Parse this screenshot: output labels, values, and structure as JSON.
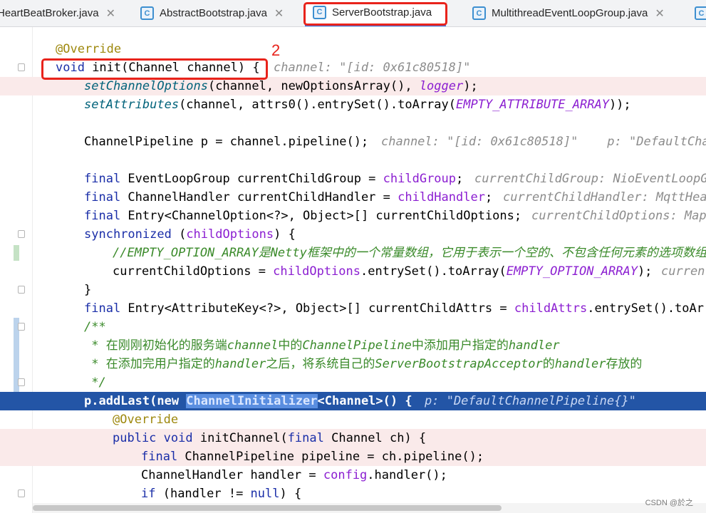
{
  "tabs": [
    {
      "label": "HeartBeatBroker.java",
      "icon": "java-class-icon"
    },
    {
      "label": "AbstractBootstrap.java",
      "icon": "java-class-icon"
    },
    {
      "label": "ServerBootstrap.java",
      "icon": "java-class-icon",
      "active": true
    },
    {
      "label": "MultithreadEventLoopGroup.java",
      "icon": "java-class-icon"
    }
  ],
  "annotations": {
    "step_number": "2"
  },
  "watermark": "CSDN @於之",
  "colors": {
    "marker": "#e8231b",
    "selection": "#2355a6",
    "breakpoint_line": "#faeaea",
    "keyword": "#1a2ea8"
  },
  "code": {
    "l1_override": "@Override",
    "l2_void": "void",
    "l2_init": " init(Channel channel) {",
    "l2_inlay": "channel: \"[id: 0x61c80518]\"",
    "l3_fn": "setChannelOptions",
    "l3_mid": "(channel, newOptionsArray(), ",
    "l3_logger": "logger",
    "l3_end": ");",
    "l4_fn": "setAttributes",
    "l4_mid": "(channel, attrs0().entrySet().toArray(",
    "l4_const": "EMPTY_ATTRIBUTE_ARRAY",
    "l4_end": "));",
    "l6_text": "ChannelPipeline p = channel.pipeline();",
    "l6_inlay": "channel: \"[id: 0x61c80518]\"    p: \"DefaultCha",
    "l8_final": "final",
    "l8_mid": " EventLoopGroup currentChildGroup = ",
    "l8_field": "childGroup",
    "l8_end": ";",
    "l8_inlay": "currentChildGroup: NioEventLoopG",
    "l9_final": "final",
    "l9_mid": " ChannelHandler currentChildHandler = ",
    "l9_field": "childHandler",
    "l9_end": ";",
    "l9_inlay": "currentChildHandler: MqttHea",
    "l10_final": "final",
    "l10_mid": " Entry<ChannelOption<?>, Object>[] currentChildOptions;",
    "l10_inlay": "currentChildOptions: Maps",
    "l11_sync": "synchronized",
    "l11_open": " (",
    "l11_field": "childOptions",
    "l11_end": ") {",
    "l12_comment": "//EMPTY_OPTION_ARRAY是Netty框架中的一个常量数组，它用于表示一个空的、不包含任何元素的选项数组",
    "l13_start": "currentChildOptions = ",
    "l13_field": "childOptions",
    "l13_mid": ".entrySet().toArray(",
    "l13_const": "EMPTY_OPTION_ARRAY",
    "l13_end": ");",
    "l13_inlay": "curren",
    "l14_text": "}",
    "l15_final": "final",
    "l15_mid": " Entry<AttributeKey<?>, Object>[] currentChildAttrs = ",
    "l15_field": "childAttrs",
    "l15_end": ".entrySet().toArra",
    "l16_doc": "/**",
    "l17_a": " * 在刚刚初始化的服务端",
    "l17_b": "channel",
    "l17_c": "中的",
    "l17_d": "ChannelPipeline",
    "l17_e": "中添加用户指定的",
    "l17_f": "handler",
    "l18_a": " * 在添加完用户指定的",
    "l18_b": "handler",
    "l18_c": "之后，将系统自己的",
    "l18_d": "ServerBootstrapAcceptor",
    "l18_e": "的",
    "l18_f": "handler",
    "l18_g": "存放的",
    "l19_doc": " */",
    "l20_start": "p.addLast(new ",
    "l20_hl": "ChannelInitializer",
    "l20_end": "<Channel>() {",
    "l20_inlay": "p: \"DefaultChannelPipeline{}\"",
    "l21_override": "@Override",
    "l22_public": "public",
    "l22_void": "void",
    "l22_mid": " initChannel(",
    "l22_final": "final",
    "l22_end": " Channel ch) {",
    "l23_final": "final",
    "l23_end": " ChannelPipeline pipeline = ch.pipeline();",
    "l24_start": "ChannelHandler handler = ",
    "l24_field": "config",
    "l24_end": ".handler();",
    "l25_if": "if",
    "l25_mid": " (handler != ",
    "l25_null": "null",
    "l25_end": ") {"
  }
}
